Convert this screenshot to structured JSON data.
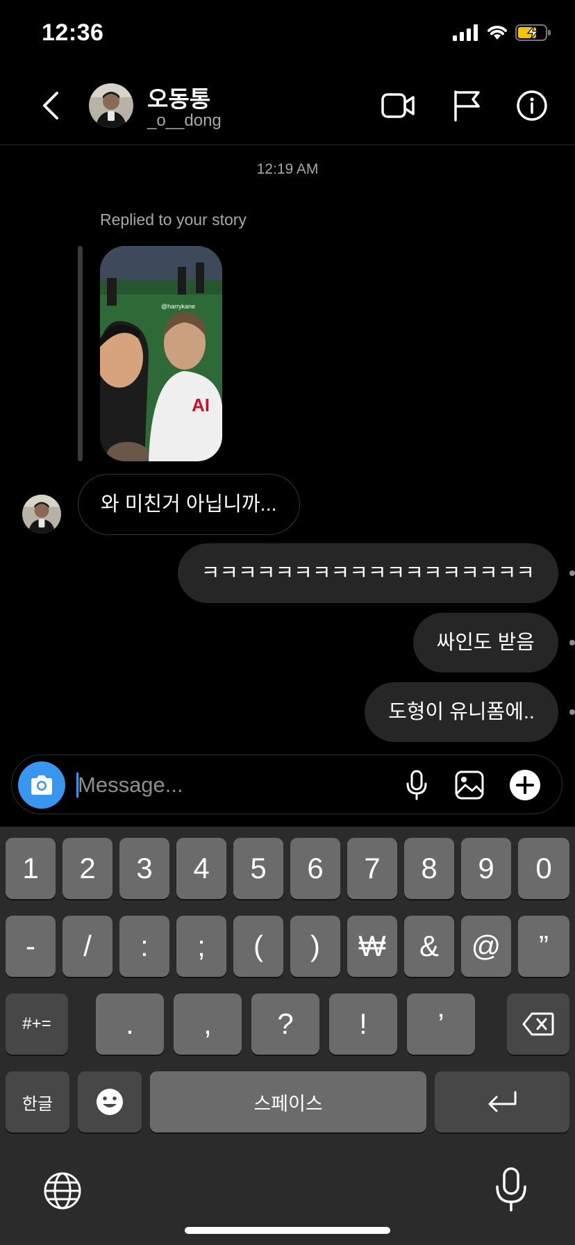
{
  "status_bar": {
    "time": "12:36"
  },
  "header": {
    "name": "오동통",
    "handle": "_o__dong"
  },
  "chat": {
    "timestamp": "12:19 AM",
    "reply_label": "Replied to your story",
    "story_caption": "@harrykane",
    "messages": [
      {
        "side": "incoming",
        "text": "와 미친거 아닙니까..."
      },
      {
        "side": "outgoing",
        "text": "ㅋㅋㅋㅋㅋㅋㅋㅋㅋㅋㅋㅋㅋㅋㅋㅋㅋㅋ"
      },
      {
        "side": "outgoing",
        "text": "싸인도 받음"
      },
      {
        "side": "outgoing",
        "text": "도형이 유니폼에.."
      }
    ]
  },
  "composer": {
    "placeholder": "Message..."
  },
  "keyboard": {
    "row1": [
      "1",
      "2",
      "3",
      "4",
      "5",
      "6",
      "7",
      "8",
      "9",
      "0"
    ],
    "row2": [
      "-",
      "/",
      ":",
      ";",
      "(",
      ")",
      "₩",
      "&",
      "@",
      "”"
    ],
    "row3": [
      ".",
      ",",
      "?",
      "!",
      "’"
    ],
    "symbols_key": "#+=",
    "lang_key": "한글",
    "space_key": "스페이스"
  },
  "colors": {
    "accent": "#3797f0",
    "bubble_out": "#262626",
    "keyboard_bg": "#2b2b2b"
  }
}
